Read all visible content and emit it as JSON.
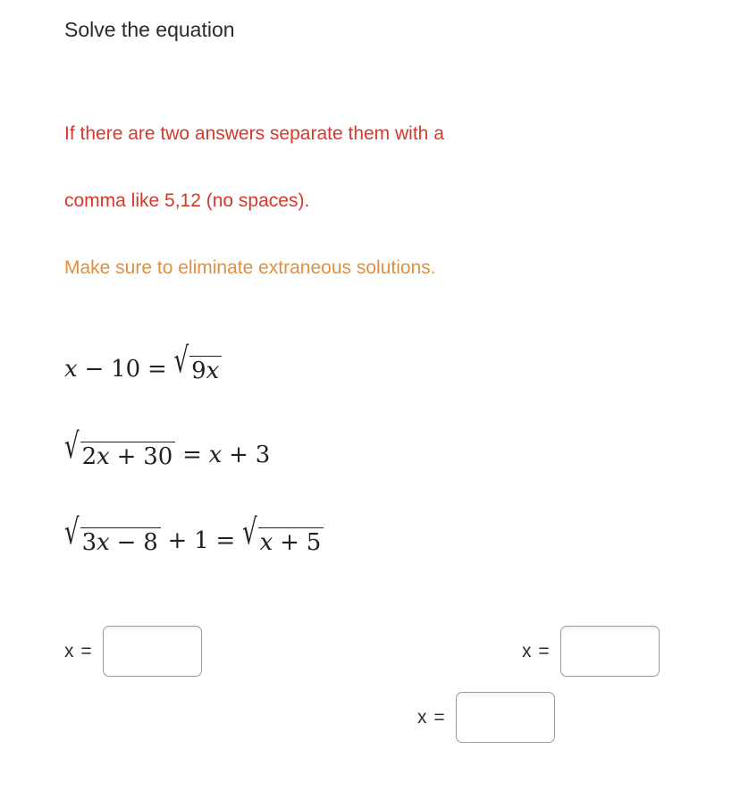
{
  "prompt": {
    "title": "Solve the equation"
  },
  "instructions": [
    {
      "text": "If there are two answers separate them with a",
      "color": "#d8382b"
    },
    {
      "text": "comma like 5,12 (no spaces).",
      "color": "#d8382b"
    },
    {
      "text": "Make sure to eliminate extraneous solutions.",
      "color": "#e38f3d"
    }
  ],
  "equations": [
    {
      "id": "equation-1",
      "plain": "x − 10 = √(9x)",
      "lhs_var": "x",
      "lhs_op": "−",
      "lhs_num": "10",
      "equals": "=",
      "radical_sign": "√",
      "radicand_coeff": "9",
      "radicand_var": "x"
    },
    {
      "id": "equation-2",
      "plain": "√(2x + 30) = x + 3",
      "radical_sign": "√",
      "radicand_coeff": "2",
      "radicand_var": "x",
      "radicand_op": "+",
      "radicand_num": "30",
      "equals": "=",
      "rhs_var": "x",
      "rhs_op": "+",
      "rhs_num": "3"
    },
    {
      "id": "equation-3",
      "plain": "√(3x − 8) + 1 = √(x + 5)",
      "radical_sign": "√",
      "radicand_coeff": "3",
      "radicand_var": "x",
      "radicand_op": "−",
      "radicand_num": "8",
      "outer_op": "+",
      "outer_num": "1",
      "equals": "=",
      "radical_sign_2": "√",
      "radicand2_var": "x",
      "radicand2_op": "+",
      "radicand2_num": "5"
    }
  ],
  "answers": [
    {
      "id": "answer-1",
      "label": "x =",
      "value": "",
      "placeholder": ""
    },
    {
      "id": "answer-2",
      "label": "x =",
      "value": "",
      "placeholder": ""
    },
    {
      "id": "answer-3",
      "label": "x =",
      "value": "",
      "placeholder": ""
    }
  ],
  "colors": {
    "text": "#2b2b2b",
    "math": "#1f2123",
    "warning_red": "#d8382b",
    "warning_orange": "#e38f3d",
    "input_border": "#9a9a9a",
    "background": "#ffffff"
  }
}
